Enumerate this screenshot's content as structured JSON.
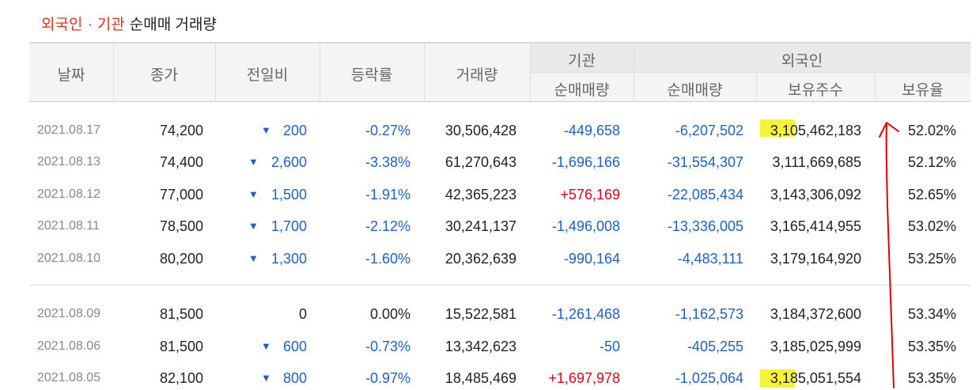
{
  "title": {
    "part1": "외국인",
    "dot": "·",
    "part2": "기관",
    "part3": "순매매 거래량"
  },
  "headers": {
    "date": "날짜",
    "close": "종가",
    "change": "전일비",
    "rate": "등락률",
    "volume": "거래량",
    "institution": "기관",
    "inst_net": "순매매량",
    "foreign": "외국인",
    "foreign_net": "순매매량",
    "foreign_holdings": "보유주수",
    "foreign_ratio": "보유율"
  },
  "group1": [
    {
      "date": "2021.08.17",
      "close": "74,200",
      "change": "200",
      "dir": "down",
      "rate": "-0.27%",
      "volume": "30,506,428",
      "inst": "-449,658",
      "foreign": "-6,207,502",
      "holdings": "3,105,462,183",
      "ratio": "52.02%"
    },
    {
      "date": "2021.08.13",
      "close": "74,400",
      "change": "2,600",
      "dir": "down",
      "rate": "-3.38%",
      "volume": "61,270,643",
      "inst": "-1,696,166",
      "foreign": "-31,554,307",
      "holdings": "3,111,669,685",
      "ratio": "52.12%"
    },
    {
      "date": "2021.08.12",
      "close": "77,000",
      "change": "1,500",
      "dir": "down",
      "rate": "-1.91%",
      "volume": "42,365,223",
      "inst": "+576,169",
      "foreign": "-22,085,434",
      "holdings": "3,143,306,092",
      "ratio": "52.65%"
    },
    {
      "date": "2021.08.11",
      "close": "78,500",
      "change": "1,700",
      "dir": "down",
      "rate": "-2.12%",
      "volume": "30,241,137",
      "inst": "-1,496,008",
      "foreign": "-13,336,005",
      "holdings": "3,165,414,955",
      "ratio": "53.02%"
    },
    {
      "date": "2021.08.10",
      "close": "80,200",
      "change": "1,300",
      "dir": "down",
      "rate": "-1.60%",
      "volume": "20,362,639",
      "inst": "-990,164",
      "foreign": "-4,483,111",
      "holdings": "3,179,164,920",
      "ratio": "53.25%"
    }
  ],
  "group2": [
    {
      "date": "2021.08.09",
      "close": "81,500",
      "change": "0",
      "dir": "none",
      "rate": "0.00%",
      "volume": "15,522,581",
      "inst": "-1,261,468",
      "foreign": "-1,162,573",
      "holdings": "3,184,372,600",
      "ratio": "53.34%"
    },
    {
      "date": "2021.08.06",
      "close": "81,500",
      "change": "600",
      "dir": "down",
      "rate": "-0.73%",
      "volume": "13,342,623",
      "inst": "-50",
      "foreign": "-405,255",
      "holdings": "3,185,025,999",
      "ratio": "53.35%"
    },
    {
      "date": "2021.08.05",
      "close": "82,100",
      "change": "800",
      "dir": "down",
      "rate": "-0.97%",
      "volume": "18,485,469",
      "inst": "+1,697,978",
      "foreign": "-1,025,064",
      "holdings": "3,185,051,554",
      "ratio": "53.35%"
    }
  ],
  "colors": {
    "accent": "#e0301e",
    "down": "#1f5fc8",
    "up": "#e0001a",
    "highlight": "#f7f33a",
    "annotation": "#e00000"
  }
}
